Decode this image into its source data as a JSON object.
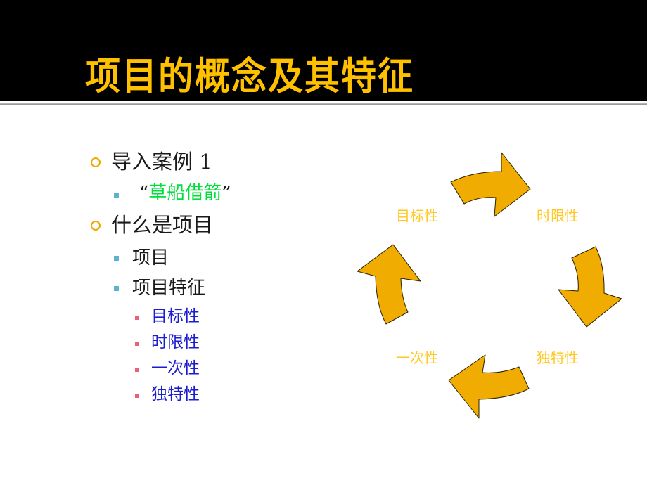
{
  "slide": {
    "title": "项目的概念及其特征",
    "colors": {
      "title_band": "#000000",
      "title_text": "#ffc000",
      "level1_marker": "#f0a800",
      "level2_marker": "#5bb4cc",
      "level3_marker": "#e8607a",
      "highlight_green": "#00e03a",
      "level3_text": "#1c1cd0",
      "arrow_fill": "#f0ac00",
      "cycle_label": "#ffc820"
    }
  },
  "outline": {
    "items": [
      {
        "level": 1,
        "text": "导入案例 1"
      },
      {
        "level": 2,
        "quote_open": "“",
        "text": "草船借箭",
        "quote_close": "”"
      },
      {
        "level": 1,
        "text": "什么是项目"
      },
      {
        "level": 2,
        "text": "项目"
      },
      {
        "level": 2,
        "text": "项目特征"
      },
      {
        "level": 3,
        "text": "目标性"
      },
      {
        "level": 3,
        "text": "时限性"
      },
      {
        "level": 3,
        "text": "一次性"
      },
      {
        "level": 3,
        "text": "独特性"
      }
    ]
  },
  "cycle_diagram": {
    "labels": [
      "目标性",
      "时限性",
      "独特性",
      "一次性"
    ],
    "arrows": [
      "arrow-top-right",
      "arrow-right-down",
      "arrow-bottom-left",
      "arrow-left-up"
    ]
  }
}
